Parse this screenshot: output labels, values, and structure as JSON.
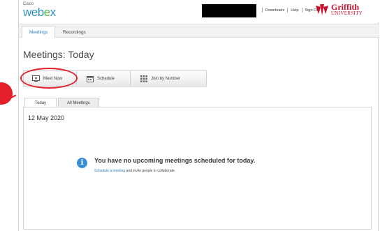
{
  "header": {
    "logo_small": "Cisco",
    "logo_main_prefix": "web",
    "logo_main_e": "e",
    "logo_main_suffix": "x",
    "links": [
      "Downloads",
      "Help",
      "Sign Out"
    ],
    "brand_line1": "Griffith",
    "brand_line2": "UNIVERSITY"
  },
  "nav": {
    "tabs": [
      {
        "label": "Meetings",
        "active": true
      },
      {
        "label": "Recordings",
        "active": false
      }
    ]
  },
  "page_title": "Meetings: Today",
  "actions": {
    "meet_now": "Meet Now",
    "schedule": "Schedule",
    "join_by_number": "Join by Number"
  },
  "annotation": {
    "color": "#e3202a"
  },
  "subtabs": [
    {
      "label": "Today",
      "active": true
    },
    {
      "label": "All Meetings",
      "active": false
    }
  ],
  "content": {
    "date": "12 May 2020",
    "empty_title": "You have no upcoming meetings scheduled for today.",
    "empty_link": "Schedule a meeting",
    "empty_rest": " and invite people to collaborate."
  },
  "colors": {
    "link": "#2a7ab8",
    "info": "#3a8fd6",
    "brand_red": "#c8102e",
    "webex_blue": "#2f8fbf",
    "webex_green": "#4db848"
  }
}
